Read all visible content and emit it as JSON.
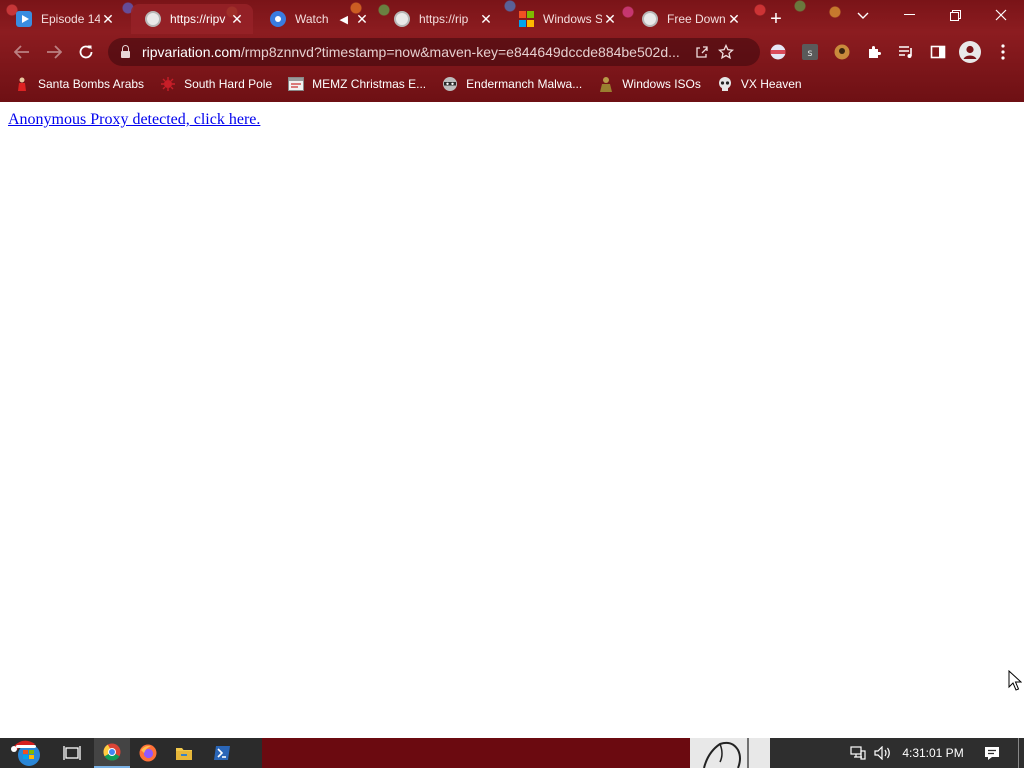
{
  "browser": {
    "tabs": [
      {
        "title": "Episode 14",
        "icon": "video-play-icon",
        "active": false,
        "muted": false
      },
      {
        "title": "https://ripv",
        "icon": "globe-icon",
        "active": true,
        "muted": false
      },
      {
        "title": "Watch",
        "icon": "watch-icon",
        "active": false,
        "muted": true
      },
      {
        "title": "https://rip",
        "icon": "globe-icon",
        "active": false,
        "muted": false
      },
      {
        "title": "Windows S",
        "icon": "microsoft-logo-icon",
        "active": false,
        "muted": false
      },
      {
        "title": "Free Down",
        "icon": "globe-icon",
        "active": false,
        "muted": false
      }
    ],
    "close_glyph": "✕",
    "newtab_glyph": "+",
    "url_host": "ripvariation.com",
    "url_rest": "/rmp8znnvd?timestamp=now&maven-key=e844649dccde884be502d...",
    "bookmarks": [
      {
        "label": "Santa Bombs Arabs"
      },
      {
        "label": "South Hard Pole"
      },
      {
        "label": "MEMZ Christmas E..."
      },
      {
        "label": "Endermanch Malwa..."
      },
      {
        "label": "Windows ISOs"
      },
      {
        "label": "VX Heaven"
      }
    ],
    "theme_color": "#7a1418"
  },
  "page": {
    "link_text": "Anonymous Proxy detected, click here.",
    "link_color": "#0000ee"
  },
  "taskbar": {
    "clock": "4:31:01 PM"
  }
}
